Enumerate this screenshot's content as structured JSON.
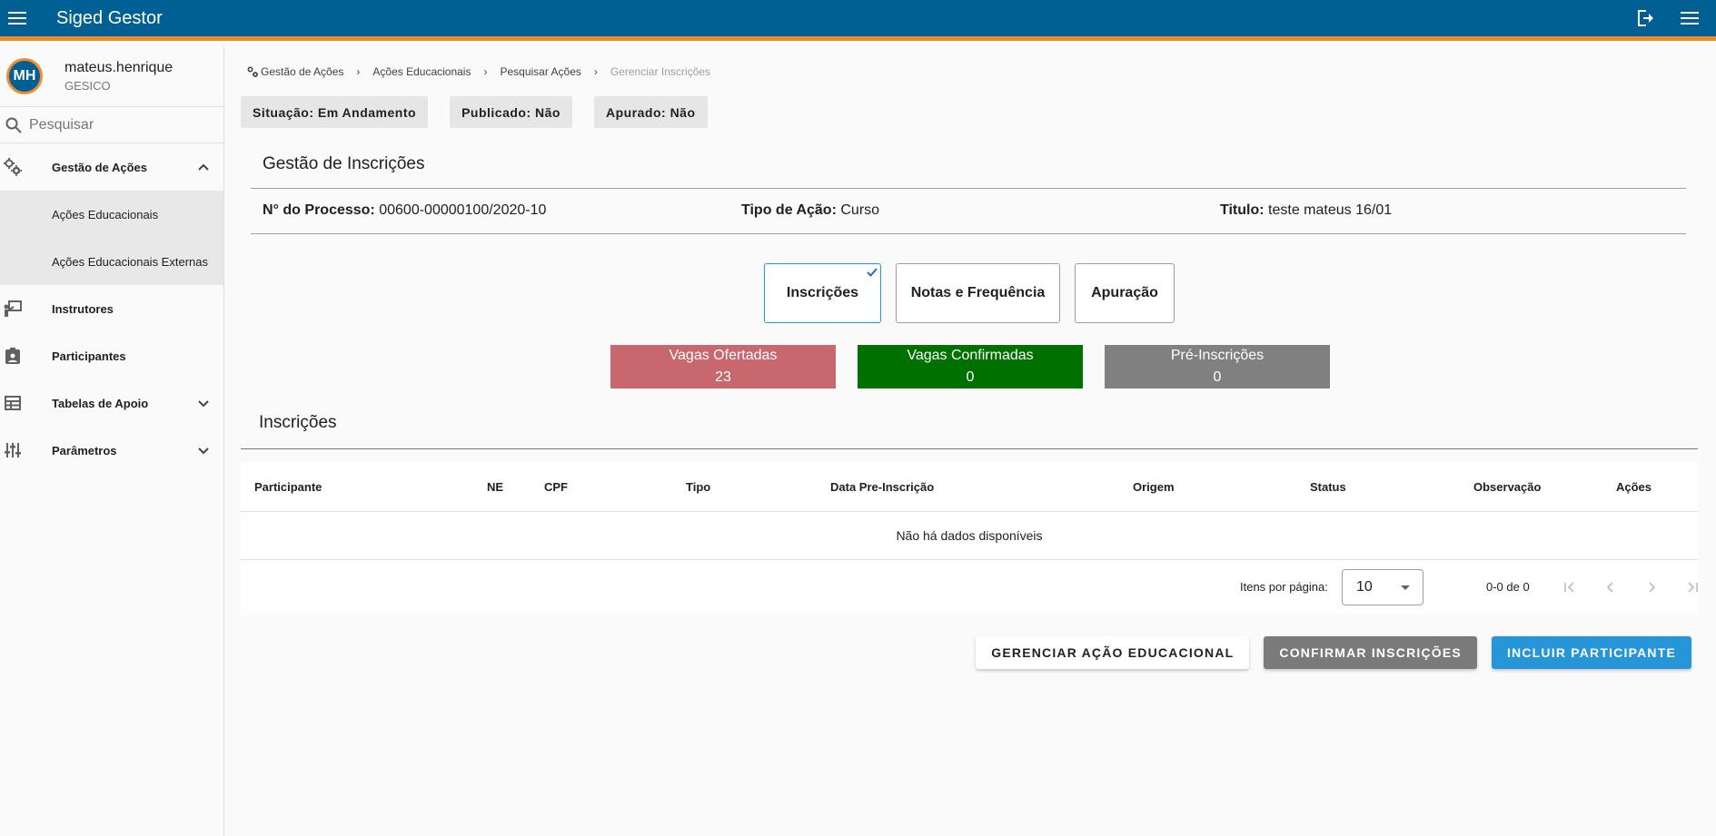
{
  "app": {
    "title": "Siged Gestor"
  },
  "user": {
    "initials": "MH",
    "name": "mateus.henrique",
    "org": "GESICO"
  },
  "search": {
    "placeholder": "Pesquisar"
  },
  "sidebar": {
    "items": [
      {
        "label": "Gestão de Ações",
        "icon": "gears-icon",
        "expanded": true,
        "children": [
          {
            "label": "Ações Educacionais"
          },
          {
            "label": "Ações Educacionais Externas"
          }
        ]
      },
      {
        "label": "Instrutores",
        "icon": "instructor-icon"
      },
      {
        "label": "Participantes",
        "icon": "badge-icon"
      },
      {
        "label": "Tabelas de Apoio",
        "icon": "table-icon",
        "expanded": false
      },
      {
        "label": "Parâmetros",
        "icon": "sliders-icon",
        "expanded": false
      }
    ]
  },
  "breadcrumb": {
    "items": [
      "Gestão de Ações",
      "Ações Educacionais",
      "Pesquisar Ações"
    ],
    "current": "Gerenciar Inscrições"
  },
  "chips": [
    "Situação: Em Andamento",
    "Publicado: Não",
    "Apurado: Não"
  ],
  "section": {
    "title": "Gestão de Inscrições"
  },
  "info": {
    "process_label": "N° do Processo:",
    "process_value": "00600-00000100/2020-10",
    "type_label": "Tipo de Ação:",
    "type_value": "Curso",
    "title_label": "Titulo:",
    "title_value": "teste mateus 16/01"
  },
  "tabs": [
    {
      "label": "Inscrições",
      "active": true
    },
    {
      "label": "Notas e Frequência",
      "active": false
    },
    {
      "label": "Apuração",
      "active": false
    }
  ],
  "stats": [
    {
      "label": "Vagas Ofertadas",
      "value": "23",
      "color": "#c9676e"
    },
    {
      "label": "Vagas Confirmadas",
      "value": "0",
      "color": "#007000"
    },
    {
      "label": "Pré-Inscrições",
      "value": "0",
      "color": "#808080"
    }
  ],
  "inscricoes": {
    "title": "Inscrições",
    "columns": [
      "Participante",
      "NE",
      "CPF",
      "Tipo",
      "Data Pre-Inscrição",
      "Origem",
      "Status",
      "Observação",
      "Ações"
    ],
    "empty": "Não há dados disponíveis",
    "paginator": {
      "label": "Itens por página:",
      "page_size": "10",
      "range": "0-0 de 0"
    }
  },
  "buttons": {
    "manage": "GERENCIAR AÇÃO EDUCACIONAL",
    "confirm": "CONFIRMAR INSCRIÇÕES",
    "include": "INCLUIR PARTICIPANTE"
  },
  "colors": {
    "primary": "#005f93",
    "accent": "#f08c2c",
    "blue_button": "#2696d8"
  }
}
